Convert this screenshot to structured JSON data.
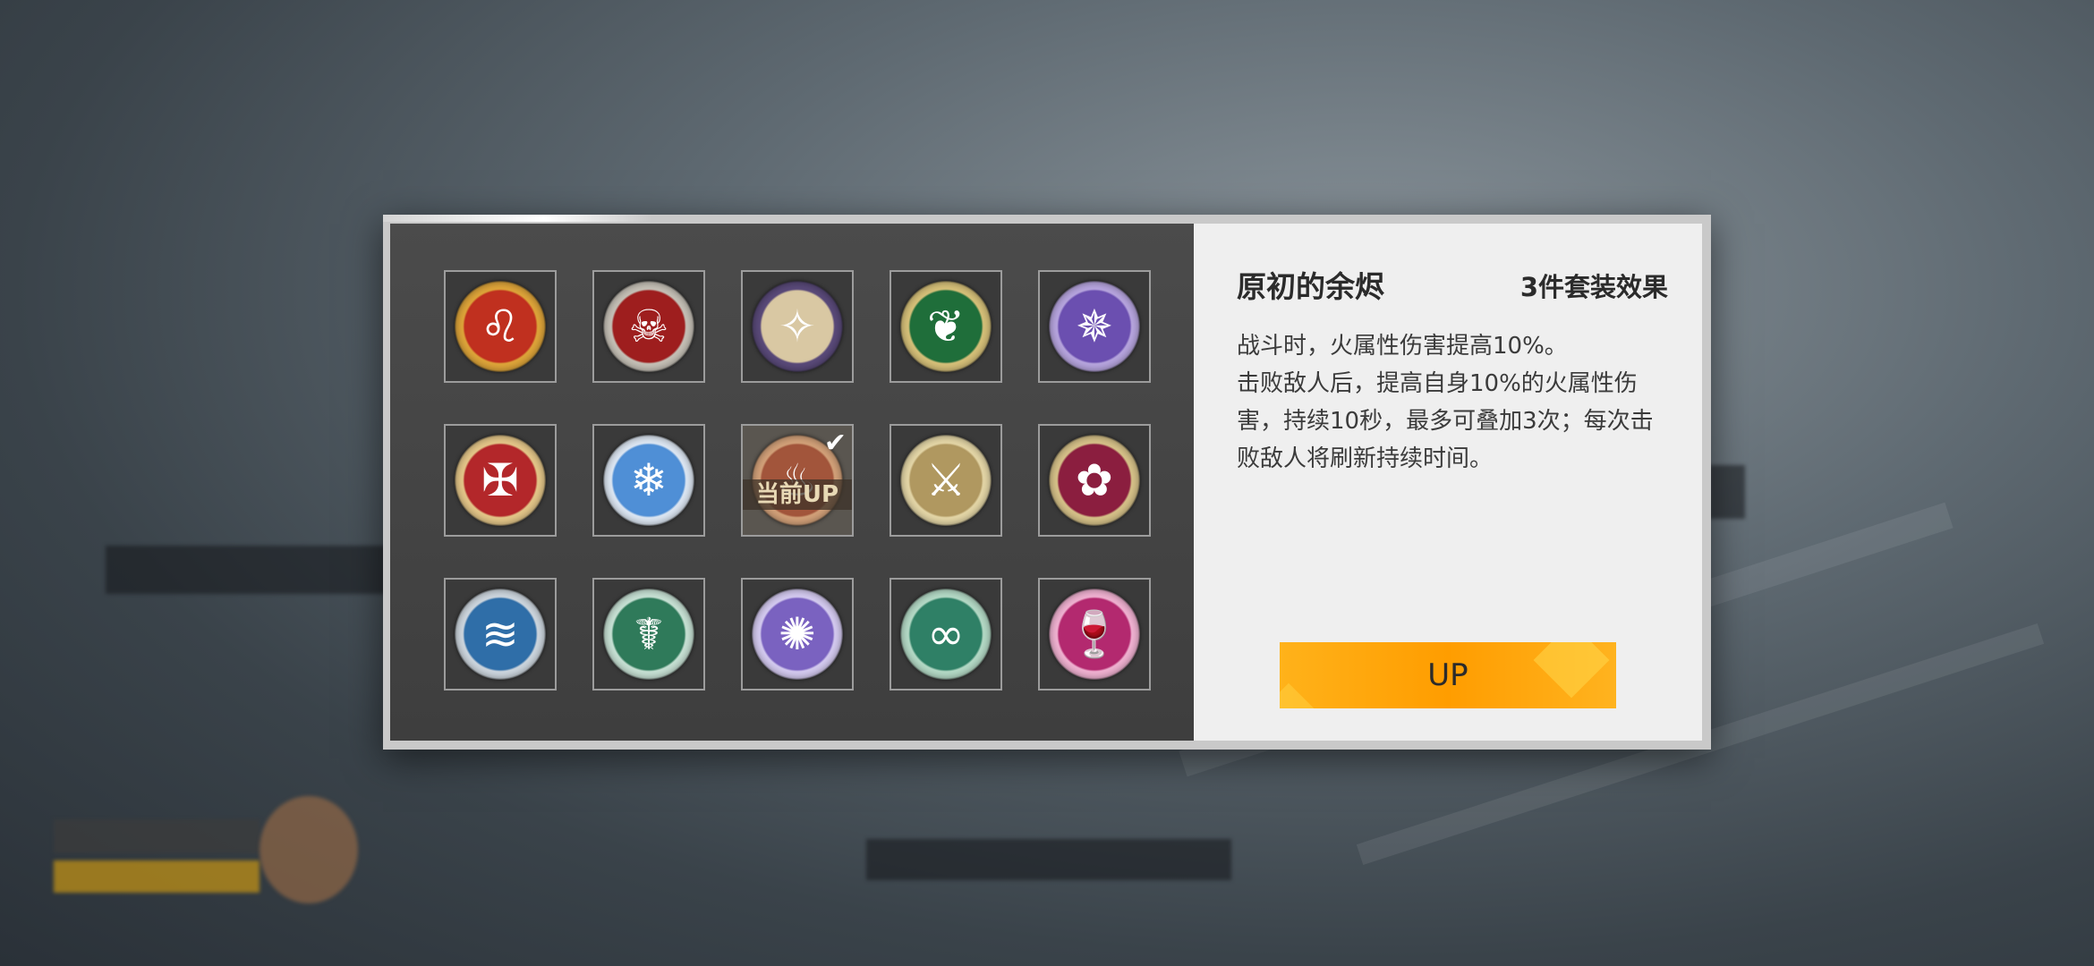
{
  "panel": {
    "title": "原初的余烬",
    "set_effect_label": "3件套装效果",
    "description": [
      "战斗时，火属性伤害提高10%。",
      "击败敌人后，提高自身10%的火属性伤害，持续10秒，最多可叠加3次；每次击败敌人将刷新持续时间。"
    ],
    "up_button_label": "UP"
  },
  "grid": {
    "current_badge": "当前UP",
    "items": [
      {
        "icon": "lion-emblem-icon",
        "glyph": "♌",
        "color": "#c0301f",
        "ring": "#e0a63a"
      },
      {
        "icon": "oni-mask-emblem-icon",
        "glyph": "☠",
        "color": "#9e1e1e",
        "ring": "#c7c2b8"
      },
      {
        "icon": "winged-eye-emblem-icon",
        "glyph": "✧",
        "color": "#d9c8a3",
        "ring": "#5a4a7a"
      },
      {
        "icon": "phoenix-emblem-icon",
        "glyph": "❦",
        "color": "#1f6e3a",
        "ring": "#d8c27a"
      },
      {
        "icon": "crystal-spire-emblem-icon",
        "glyph": "✵",
        "color": "#6b4fb0",
        "ring": "#b8a6e0"
      },
      {
        "icon": "flame-crest-emblem-icon",
        "glyph": "✠",
        "color": "#b3272a",
        "ring": "#e6c88a"
      },
      {
        "icon": "frost-wings-emblem-icon",
        "glyph": "❄",
        "color": "#4f8fd6",
        "ring": "#dfe9f5"
      },
      {
        "icon": "ember-emblem-icon",
        "glyph": "♨",
        "color": "#a2553b",
        "ring": "#d4a27a"
      },
      {
        "icon": "crossed-swords-emblem-icon",
        "glyph": "⚔",
        "color": "#b09860",
        "ring": "#e6d8a8"
      },
      {
        "icon": "fox-mask-emblem-icon",
        "glyph": "✿",
        "color": "#8b1e3f",
        "ring": "#d8c38a"
      },
      {
        "icon": "water-dragon-emblem-icon",
        "glyph": "≋",
        "color": "#2f6ea8",
        "ring": "#cfd8e0"
      },
      {
        "icon": "serpent-vase-emblem-icon",
        "glyph": "☤",
        "color": "#2f7a5a",
        "ring": "#c9e3d6"
      },
      {
        "icon": "violet-beast-emblem-icon",
        "glyph": "✺",
        "color": "#7a62c0",
        "ring": "#d6ccf2"
      },
      {
        "icon": "ouroboros-emblem-icon",
        "glyph": "∞",
        "color": "#2f8066",
        "ring": "#b6dcc8"
      },
      {
        "icon": "chalice-emblem-icon",
        "glyph": "🍷",
        "color": "#b3296f",
        "ring": "#f2b3d3"
      }
    ],
    "selected_index": 7
  },
  "colors": {
    "accent": "#ffa70f",
    "panel_bg": "#efefef",
    "grid_bg": "#444444"
  }
}
